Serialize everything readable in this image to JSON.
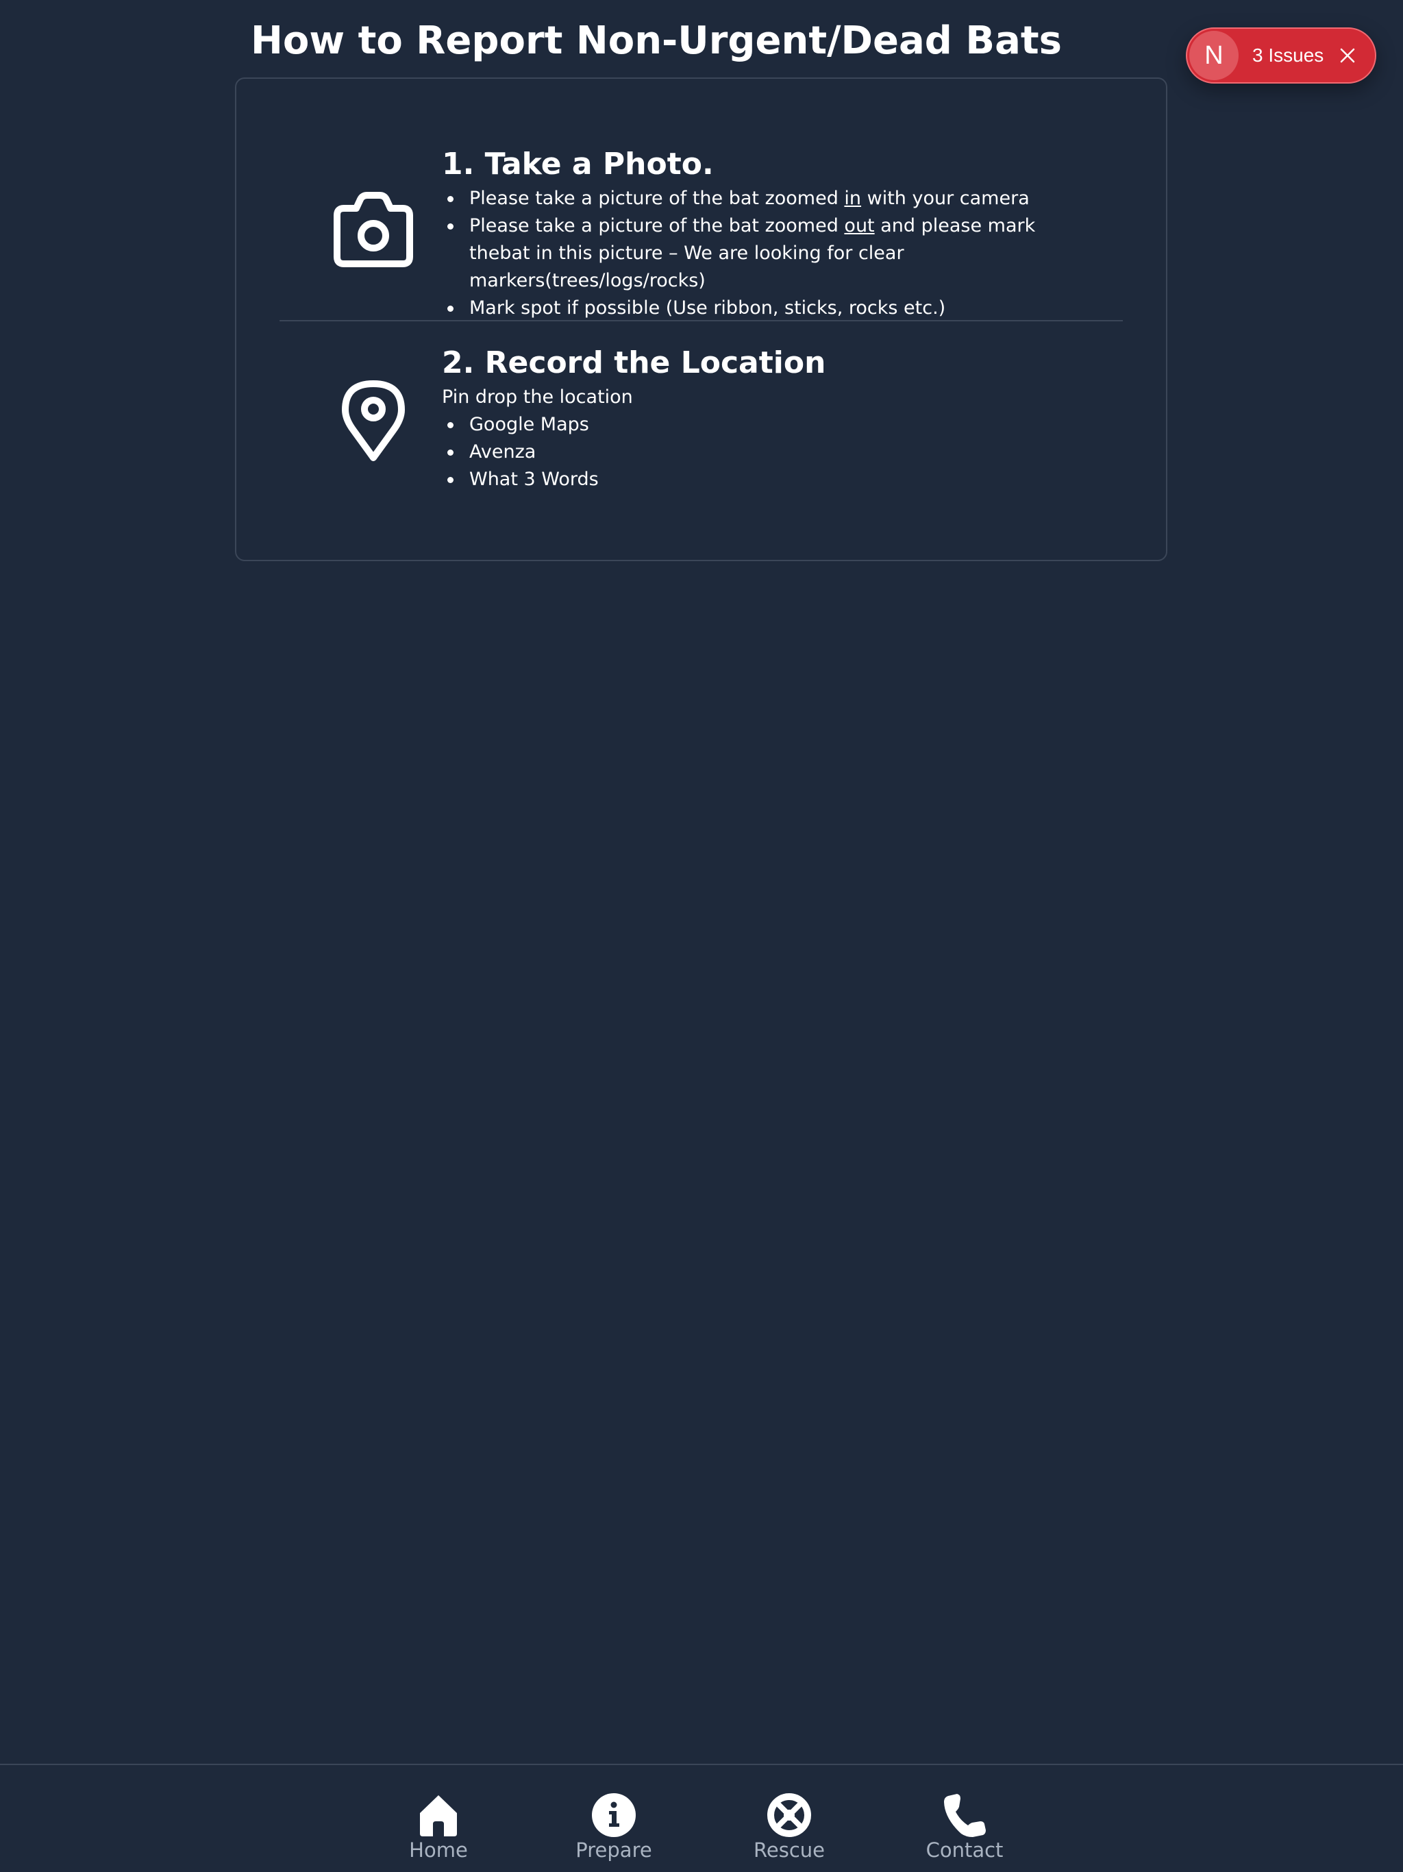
{
  "page": {
    "title": "How to Report Non-Urgent/Dead Bats"
  },
  "steps": [
    {
      "heading": "1. Take a Photo.",
      "icon": "camera-icon",
      "bullets": [
        {
          "before": "Please take a picture of the bat zoomed ",
          "emphasis": "in",
          "after": " with your camera"
        },
        {
          "before": "Please take a picture of the bat zoomed ",
          "emphasis": "out",
          "after": " and please mark thebat in this picture – We are looking for clear markers(trees/logs/rocks)"
        },
        {
          "text": "Mark spot if possible (Use ribbon, sticks, rocks etc.)"
        }
      ]
    },
    {
      "heading": "2. Record the Location",
      "icon": "map-pin-icon",
      "intro": "Pin drop the location",
      "bullets": [
        "Google Maps",
        "Avenza",
        "What 3 Words"
      ]
    }
  ],
  "issues_badge": {
    "logo_letter": "N",
    "label": "3 Issues",
    "close_icon": "close-icon"
  },
  "nav": {
    "items": [
      {
        "label": "Home",
        "icon": "home-icon"
      },
      {
        "label": "Prepare",
        "icon": "info-icon"
      },
      {
        "label": "Rescue",
        "icon": "lifebuoy-icon"
      },
      {
        "label": "Contact",
        "icon": "phone-icon"
      }
    ]
  },
  "colors": {
    "background": "#1e293b",
    "card_border": "#3b4658",
    "text": "#ffffff",
    "nav_label": "#aab4c2",
    "issues_badge": "#d22a35"
  }
}
